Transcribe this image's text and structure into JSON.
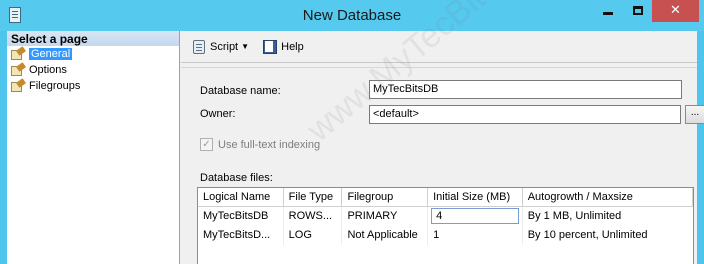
{
  "window": {
    "title": "New Database",
    "controls": {
      "minimize_icon": "minimize-icon",
      "maximize_icon": "maximize-icon",
      "close_glyph": "✕"
    },
    "colors": {
      "frame": "#56c9ef",
      "close": "#c75050",
      "selection": "#3399ff"
    }
  },
  "sidebar": {
    "heading": "Select a page",
    "items": [
      {
        "label": "General",
        "icon": "page-wrench-icon",
        "selected": true
      },
      {
        "label": "Options",
        "icon": "page-wrench-icon",
        "selected": false
      },
      {
        "label": "Filegroups",
        "icon": "page-wrench-icon",
        "selected": false
      }
    ]
  },
  "toolbar": {
    "script_label": "Script",
    "script_dropdown_glyph": "▼",
    "help_label": "Help"
  },
  "form": {
    "db_name_label": "Database name:",
    "db_name_value": "MyTecBitsDB",
    "owner_label": "Owner:",
    "owner_value": "<default>",
    "browse_label": "...",
    "fulltext_label": "Use full-text indexing",
    "fulltext_checked": true,
    "fulltext_check_glyph": "✓",
    "files_label": "Database files:"
  },
  "files_table": {
    "columns": [
      "Logical Name",
      "File Type",
      "Filegroup",
      "Initial Size (MB)",
      "Autogrowth / Maxsize"
    ],
    "rows": [
      [
        "MyTecBitsDB",
        "ROWS...",
        "PRIMARY",
        "4",
        "By 1 MB, Unlimited"
      ],
      [
        "MyTecBitsD...",
        "LOG",
        "Not Applicable",
        "1",
        "By 10 percent, Unlimited"
      ]
    ]
  },
  "watermark": "www.MyTecBits.com"
}
